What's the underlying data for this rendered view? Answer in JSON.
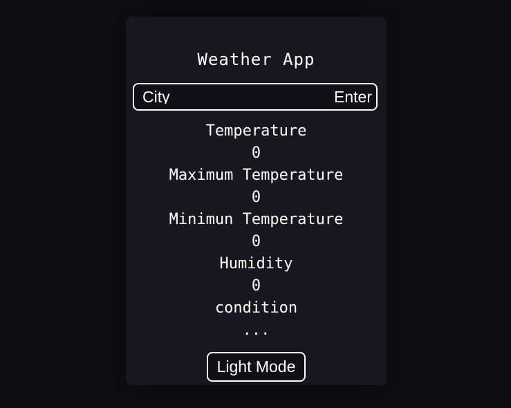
{
  "app": {
    "title": "Weather App"
  },
  "search": {
    "placeholder": "City",
    "value": "",
    "enter_label": "Enter"
  },
  "weather": {
    "temperature_label": "Temperature",
    "temperature_value": "0",
    "max_temperature_label": "Maximum Temperature",
    "max_temperature_value": "0",
    "min_temperature_label": "Minimun Temperature",
    "min_temperature_value": "0",
    "humidity_label": "Humidity",
    "humidity_value": "0",
    "condition_label": "condition",
    "condition_value": "..."
  },
  "theme": {
    "toggle_label": "Light Mode"
  },
  "colors": {
    "background": "#0f0e15",
    "card": "#18171f",
    "text": "#ffffff"
  }
}
